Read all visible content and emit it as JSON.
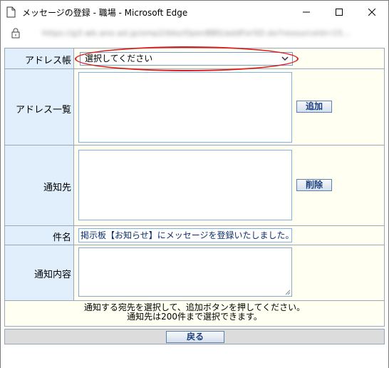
{
  "window": {
    "title": "メッセージの登録 - 職場 - Microsoft Edge",
    "url": "https://g3.wb.ano.ad.jp/omp2/bbs/OpenBBS/addForSD.do?resourceId=15..."
  },
  "form": {
    "address_book": {
      "label": "アドレス帳",
      "selected": "選択してください"
    },
    "address_list": {
      "label": "アドレス一覧",
      "add_button": "追加"
    },
    "destination": {
      "label": "通知先",
      "delete_button": "削除"
    },
    "subject": {
      "label": "件名",
      "value": "掲示板【お知らせ】にメッセージを登録いたしました。"
    },
    "body": {
      "label": "通知内容",
      "value": ""
    },
    "note_line1": "通知する宛先を選択して、追加ボタンを押してください。",
    "note_line2": "通知先は200件まで選択できます。"
  },
  "footer": {
    "back_button": "戻る"
  },
  "colors": {
    "label_bg": "#e1effc",
    "value_bg": "#fffff2",
    "highlight": "#e01b1b",
    "button_text": "#1a3d7c"
  }
}
